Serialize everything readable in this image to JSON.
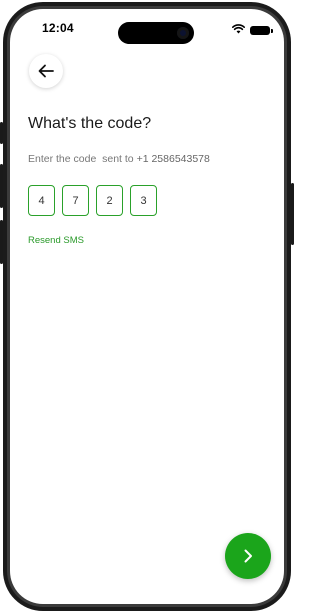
{
  "status_bar": {
    "time": "12:04"
  },
  "icons": {
    "back": "arrow-left-icon",
    "next": "chevron-right-icon",
    "wifi": "wifi-icon",
    "battery": "battery-icon"
  },
  "verify": {
    "title": "What's the code?",
    "subtitle_prefix": "Enter the code  sent to ",
    "phone_number": "+1 2586543578",
    "code_digits": [
      "4",
      "7",
      "2",
      "3"
    ],
    "resend_label": "Resend SMS"
  },
  "colors": {
    "accent": "#1ba51b",
    "box_border": "#2aa12a"
  }
}
